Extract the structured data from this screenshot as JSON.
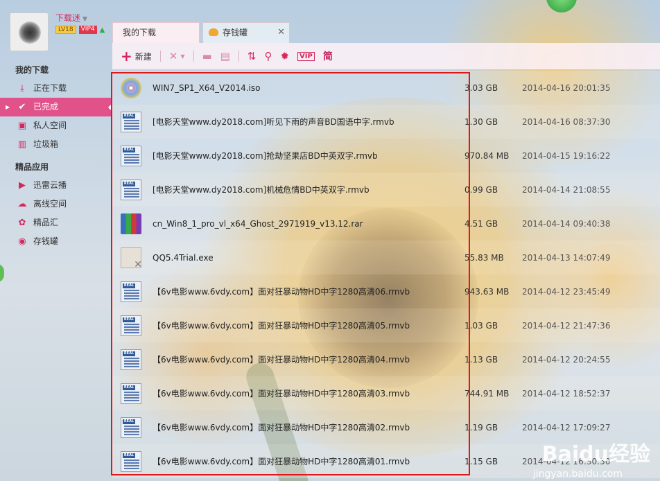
{
  "user": {
    "name": "下载迷",
    "level": "LV18",
    "vip": "VIP4"
  },
  "tabs": [
    {
      "label": "我的下载",
      "active": true
    },
    {
      "label": "存钱罐",
      "active": false,
      "close": "✕"
    }
  ],
  "toolbar": {
    "new_label": "新建",
    "simplified_label": "简"
  },
  "sidebar": {
    "section1_title": "我的下载",
    "items1": [
      {
        "label": "正在下载",
        "icon": "download-icon"
      },
      {
        "label": "已完成",
        "icon": "check-icon",
        "selected": true
      },
      {
        "label": "私人空间",
        "icon": "lock-icon"
      },
      {
        "label": "垃圾箱",
        "icon": "trash-icon"
      }
    ],
    "section2_title": "精品应用",
    "items2": [
      {
        "label": "迅雷云播",
        "icon": "cloud-play-icon"
      },
      {
        "label": "离线空间",
        "icon": "cloud-icon"
      },
      {
        "label": "精品汇",
        "icon": "app-icon"
      },
      {
        "label": "存钱罐",
        "icon": "piggy-bank-icon"
      }
    ]
  },
  "files": [
    {
      "name": "WIN7_SP1_X64_V2014.iso",
      "size": "3.03 GB",
      "date": "2014-04-16 20:01:35",
      "type": "iso"
    },
    {
      "name": "[电影天堂www.dy2018.com]听见下雨的声音BD国语中字.rmvb",
      "size": "1.30 GB",
      "date": "2014-04-16 08:37:30",
      "type": "rmvb"
    },
    {
      "name": "[电影天堂www.dy2018.com]抢劫坚果店BD中英双字.rmvb",
      "size": "970.84 MB",
      "date": "2014-04-15 19:16:22",
      "type": "rmvb"
    },
    {
      "name": "[电影天堂www.dy2018.com]机械危情BD中英双字.rmvb",
      "size": "0.99 GB",
      "date": "2014-04-14 21:08:55",
      "type": "rmvb"
    },
    {
      "name": "cn_Win8_1_pro_vl_x64_Ghost_2971919_v13.12.rar",
      "size": "4.51 GB",
      "date": "2014-04-14 09:40:38",
      "type": "rar"
    },
    {
      "name": "QQ5.4Trial.exe",
      "size": "55.83 MB",
      "date": "2014-04-13 14:07:49",
      "type": "exe"
    },
    {
      "name": "【6v电影www.6vdy.com】面对狂暴动物HD中字1280高清06.rmvb",
      "size": "943.63 MB",
      "date": "2014-04-12 23:45:49",
      "type": "rmvb"
    },
    {
      "name": "【6v电影www.6vdy.com】面对狂暴动物HD中字1280高清05.rmvb",
      "size": "1.03 GB",
      "date": "2014-04-12 21:47:36",
      "type": "rmvb"
    },
    {
      "name": "【6v电影www.6vdy.com】面对狂暴动物HD中字1280高清04.rmvb",
      "size": "1.13 GB",
      "date": "2014-04-12 20:24:55",
      "type": "rmvb"
    },
    {
      "name": "【6v电影www.6vdy.com】面对狂暴动物HD中字1280高清03.rmvb",
      "size": "744.91 MB",
      "date": "2014-04-12 18:52:37",
      "type": "rmvb"
    },
    {
      "name": "【6v电影www.6vdy.com】面对狂暴动物HD中字1280高清02.rmvb",
      "size": "1.19 GB",
      "date": "2014-04-12 17:09:27",
      "type": "rmvb"
    },
    {
      "name": "【6v电影www.6vdy.com】面对狂暴动物HD中字1280高清01.rmvb",
      "size": "1.15 GB",
      "date": "2014-04-12 16:30:50",
      "type": "rmvb"
    }
  ],
  "watermark": {
    "brand": "Baidu经验",
    "url": "jingyan.baidu.com"
  },
  "colors": {
    "accent": "#d6265c",
    "selection": "#e2528a",
    "highlight_box": "#e01818"
  }
}
